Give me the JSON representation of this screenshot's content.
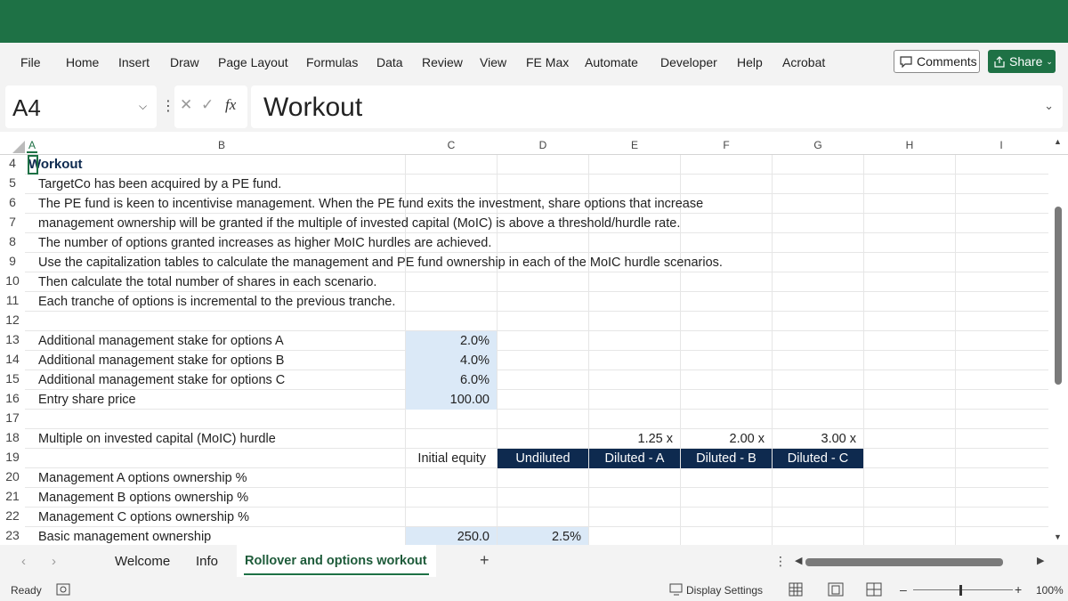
{
  "ribbon": {
    "tabs": [
      "File",
      "Home",
      "Insert",
      "Draw",
      "Page Layout",
      "Formulas",
      "Data",
      "Review",
      "View",
      "FE Max",
      "Automate",
      "Developer",
      "Help",
      "Acrobat"
    ],
    "comments_label": "Comments",
    "share_label": "Share"
  },
  "formula_bar": {
    "name_box": "A4",
    "fx": "fx",
    "content": "Workout"
  },
  "columns": [
    "A",
    "B",
    "C",
    "D",
    "E",
    "F",
    "G",
    "H",
    "I"
  ],
  "rows": {
    "r4": {
      "num": "4",
      "a": "Workout"
    },
    "r5": {
      "num": "5",
      "b": "TargetCo has been acquired by a PE fund."
    },
    "r6": {
      "num": "6",
      "b": "The PE fund is keen to incentivise management. When the PE fund exits the investment, share options that increase"
    },
    "r7": {
      "num": "7",
      "b": "management ownership will be granted if the multiple of invested capital (MoIC) is above a threshold/hurdle rate."
    },
    "r8": {
      "num": "8",
      "b": "The number of options granted increases as higher MoIC hurdles are achieved."
    },
    "r9": {
      "num": "9",
      "b": "Use the capitalization tables to calculate the management and PE fund ownership in each of the MoIC hurdle scenarios."
    },
    "r10": {
      "num": "10",
      "b": "Then calculate the total number of shares in each scenario."
    },
    "r11": {
      "num": "11",
      "b": "Each tranche of options is incremental to the previous tranche."
    },
    "r12": {
      "num": "12"
    },
    "r13": {
      "num": "13",
      "b": "Additional management stake for options A",
      "c": "2.0%"
    },
    "r14": {
      "num": "14",
      "b": "Additional management stake for options B",
      "c": "4.0%"
    },
    "r15": {
      "num": "15",
      "b": "Additional management stake for options C",
      "c": "6.0%"
    },
    "r16": {
      "num": "16",
      "b": "Entry share price",
      "c": "100.00"
    },
    "r17": {
      "num": "17"
    },
    "r18": {
      "num": "18",
      "b": "Multiple on invested capital (MoIC) hurdle",
      "e": "1.25 x",
      "f": "2.00 x",
      "g": "3.00 x"
    },
    "r19": {
      "num": "19",
      "c": "Initial equity",
      "d": "Undiluted",
      "e": "Diluted - A",
      "f": "Diluted - B",
      "g": "Diluted - C"
    },
    "r20": {
      "num": "20",
      "b": "Management A options ownership %"
    },
    "r21": {
      "num": "21",
      "b": "Management B options ownership %"
    },
    "r22": {
      "num": "22",
      "b": "Management C options ownership %"
    },
    "r23": {
      "num": "23",
      "b": "Basic management ownership",
      "c": "250.0",
      "d": "2.5%"
    }
  },
  "sheets": {
    "tabs": [
      "Welcome",
      "Info",
      "Rollover and options workout"
    ],
    "active": "Rollover and options workout",
    "add": "+"
  },
  "status": {
    "mode": "Ready",
    "display_settings": "Display Settings",
    "zoom": "100%"
  },
  "colors": {
    "accent": "#1e7145",
    "input_fill": "#dbe9f7",
    "header_fill": "#0e2a4f"
  }
}
